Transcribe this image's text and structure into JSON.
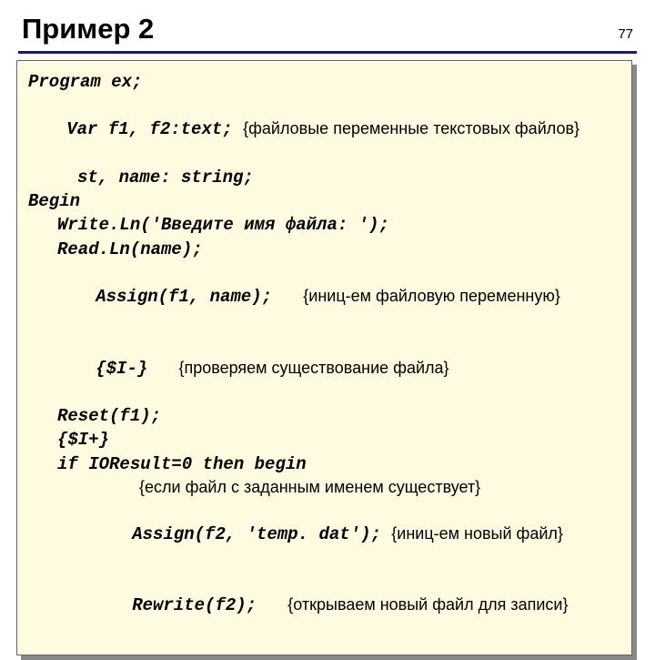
{
  "header": {
    "title": "Пример 2",
    "page": "77"
  },
  "code": {
    "l1": "Program ex;",
    "l2a": "Var f1, f2:text; ",
    "l2b": "{файловые переменные текстовых файлов}",
    "l3": "st, name: string;",
    "l4": "Begin",
    "l5": "Write.Ln('Введите имя файла: ');",
    "l6": "Read.Ln(name);",
    "l7a": "Assign(f1, name);   ",
    "l7b": "{иниц-ем файловую переменную}",
    "l8a": "{$I-}   ",
    "l8b": "{проверяем существование файла}",
    "l9": "Reset(f1);",
    "l10": "{$I+}",
    "l11": "if IOResult=0 then begin",
    "l12": "{если файл с заданным именем существует}",
    "l13a": "Assign(f2, 'temp. dat'); ",
    "l13b": "{иниц-ем новый файл}",
    "l14a": "Rewrite(f2);   ",
    "l14b": "{открываем новый файл для записи}"
  }
}
